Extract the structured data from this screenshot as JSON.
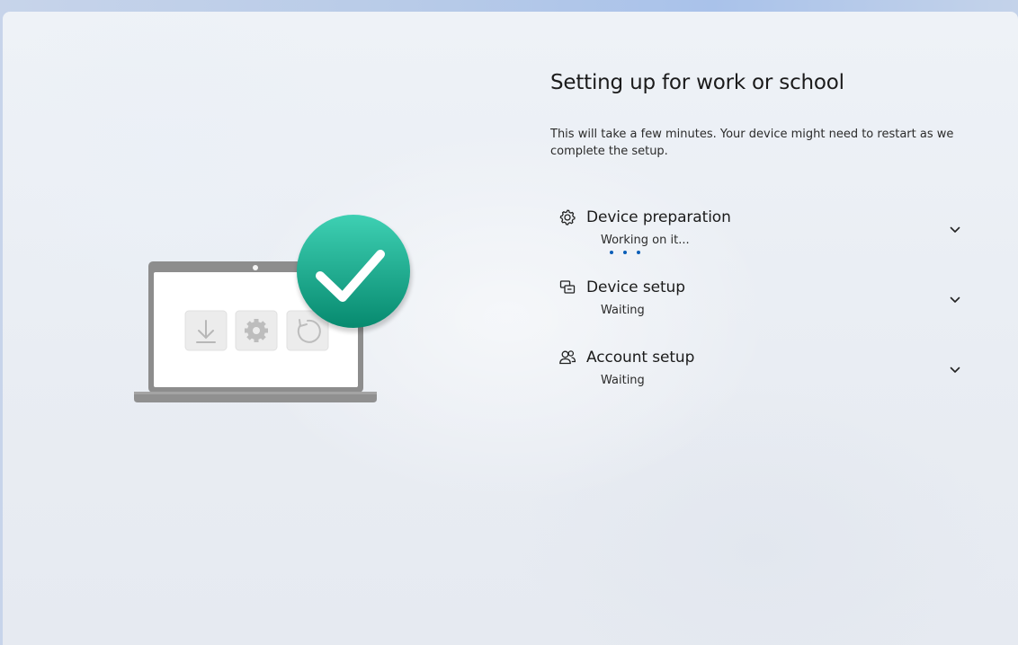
{
  "page": {
    "title": "Setting up for work or school",
    "subtitle": "This will take a few minutes. Your device might need to restart as we complete the setup."
  },
  "steps": [
    {
      "title": "Device preparation",
      "status": "Working on it...",
      "icon": "gear-icon",
      "in_progress": true
    },
    {
      "title": "Device setup",
      "status": "Waiting",
      "icon": "device-setup-icon",
      "in_progress": false
    },
    {
      "title": "Account setup",
      "status": "Waiting",
      "icon": "people-icon",
      "in_progress": false
    }
  ],
  "illustration": {
    "tiles": [
      "download-icon",
      "gear-icon",
      "restart-icon"
    ],
    "badge": "checkmark-icon"
  },
  "colors": {
    "accent": "#0a5eb8",
    "check_badge": "#119b7e",
    "laptop_frame": "#8f8f8f"
  }
}
